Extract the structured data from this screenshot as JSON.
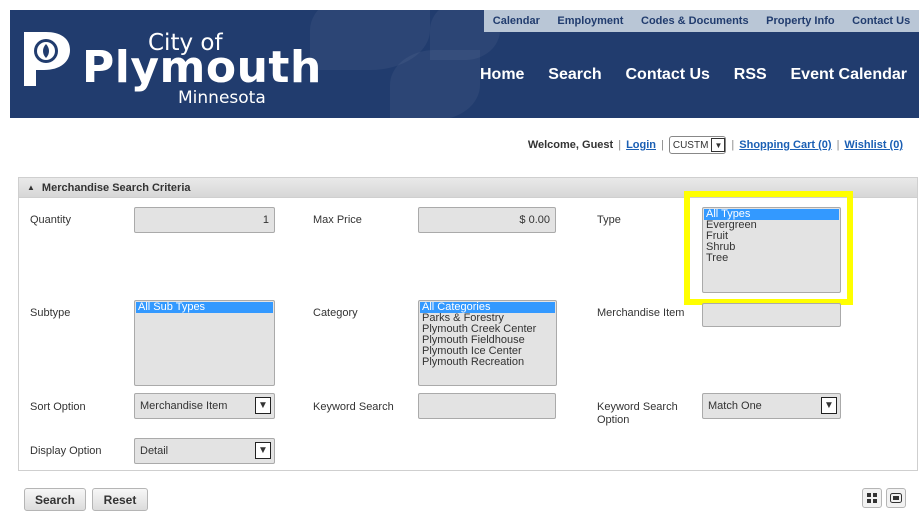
{
  "header": {
    "logo": {
      "city_of": "City of",
      "name": "Plymouth",
      "state": "Minnesota"
    },
    "top_links": [
      "Calendar",
      "Employment",
      "Codes & Documents",
      "Property Info",
      "Contact Us"
    ],
    "main_nav": [
      "Home",
      "Search",
      "Contact Us",
      "RSS",
      "Event Calendar"
    ]
  },
  "welcome_bar": {
    "greeting": "Welcome, Guest",
    "login": "Login",
    "customer_select": "CUSTM",
    "cart": "Shopping Cart (0)",
    "wishlist": "Wishlist (0)"
  },
  "panel": {
    "title": "Merchandise Search Criteria",
    "quantity": {
      "label": "Quantity",
      "value": "1"
    },
    "max_price": {
      "label": "Max Price",
      "value": "$ 0.00"
    },
    "type": {
      "label": "Type",
      "options": [
        "All Types",
        "Evergreen",
        "Fruit",
        "Shrub",
        "Tree"
      ],
      "selected": "All Types"
    },
    "subtype": {
      "label": "Subtype",
      "options": [
        "All Sub Types"
      ],
      "selected": "All Sub Types"
    },
    "category": {
      "label": "Category",
      "options": [
        "All Categories",
        "Parks & Forestry",
        "Plymouth Creek Center",
        "Plymouth Fieldhouse",
        "Plymouth Ice Center",
        "Plymouth Recreation"
      ],
      "selected": "All Categories"
    },
    "merchandise_item": {
      "label": "Merchandise Item",
      "value": ""
    },
    "sort_option": {
      "label": "Sort Option",
      "value": "Merchandise Item"
    },
    "keyword_search": {
      "label": "Keyword Search",
      "value": ""
    },
    "keyword_search_option": {
      "label": "Keyword Search Option",
      "value": "Match One"
    },
    "display_option": {
      "label": "Display Option",
      "value": "Detail"
    }
  },
  "buttons": {
    "search": "Search",
    "reset": "Reset"
  },
  "colors": {
    "header_bg": "#213c6e",
    "top_bar_bg": "#b9c6d6",
    "selection": "#3399ff",
    "highlight": "#ffff00",
    "link": "#1a5fb4"
  }
}
